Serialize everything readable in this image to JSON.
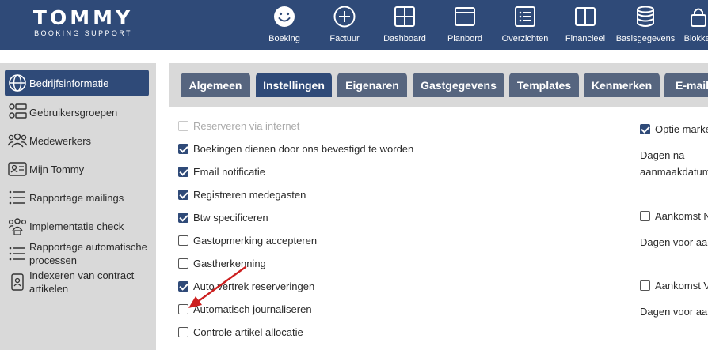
{
  "app": {
    "logo_title": "TOMMY",
    "logo_subtitle": "BOOKING SUPPORT"
  },
  "topnav": [
    {
      "label": "Boeking",
      "icon": "smiley-icon"
    },
    {
      "label": "Factuur",
      "icon": "plus-circle-icon"
    },
    {
      "label": "Dashboard",
      "icon": "grid-icon"
    },
    {
      "label": "Planbord",
      "icon": "window-icon"
    },
    {
      "label": "Overzichten",
      "icon": "list-box-icon"
    },
    {
      "label": "Financieel",
      "icon": "book-icon"
    },
    {
      "label": "Basisgegevens",
      "icon": "database-icon"
    },
    {
      "label": "Blokker",
      "icon": "lock-icon"
    }
  ],
  "sidebar": {
    "items": [
      {
        "label": "Bedrijfsinformatie",
        "icon": "globe-icon",
        "active": true
      },
      {
        "label": "Gebruikersgroepen",
        "icon": "user-groups-icon"
      },
      {
        "label": "Medewerkers",
        "icon": "people-icon"
      },
      {
        "label": "Mijn Tommy",
        "icon": "id-card-icon"
      },
      {
        "label": "Rapportage mailings",
        "icon": "list-icon"
      },
      {
        "label": "Implementatie check",
        "icon": "team-check-icon"
      },
      {
        "label": "Rapportage automatische processen",
        "icon": "list-icon"
      },
      {
        "label": "Indexeren van contract artikelen",
        "icon": "document-user-icon"
      }
    ]
  },
  "tabs": [
    {
      "label": "Algemeen"
    },
    {
      "label": "Instellingen",
      "active": true
    },
    {
      "label": "Eigenaren"
    },
    {
      "label": "Gastgegevens"
    },
    {
      "label": "Templates"
    },
    {
      "label": "Kenmerken"
    },
    {
      "label": "E-mail"
    }
  ],
  "settings": [
    {
      "label": "Reserveren via internet",
      "checked": false,
      "disabled": true
    },
    {
      "label": "Boekingen dienen door ons bevestigd te worden",
      "checked": true
    },
    {
      "label": "Email notificatie",
      "checked": true
    },
    {
      "label": "Registreren medegasten",
      "checked": true
    },
    {
      "label": "Btw specificeren",
      "checked": true
    },
    {
      "label": "Gastopmerking accepteren",
      "checked": false
    },
    {
      "label": "Gastherkenning",
      "checked": false
    },
    {
      "label": "Auto vertrek reserveringen",
      "checked": true
    },
    {
      "label": "Automatisch journaliseren",
      "checked": false
    },
    {
      "label": "Controle artikel allocatie",
      "checked": false
    }
  ],
  "right_column": {
    "optie_label": "Optie marke",
    "optie_checked": true,
    "dagen_na_line1": "Dagen na",
    "dagen_na_line2": "aanmaakdatum",
    "aankomst_n_label": "Aankomst N",
    "aankomst_n_checked": false,
    "dagen_voor_1": "Dagen voor aa",
    "aankomst_v_label": "Aankomst V",
    "aankomst_v_checked": false,
    "dagen_voor_2": "Dagen voor aa"
  },
  "colors": {
    "brand": "#2f4a78",
    "tab_inactive": "#56657f",
    "panel_bg": "#d9d9d9",
    "annotation_arrow": "#cc1f1f"
  }
}
